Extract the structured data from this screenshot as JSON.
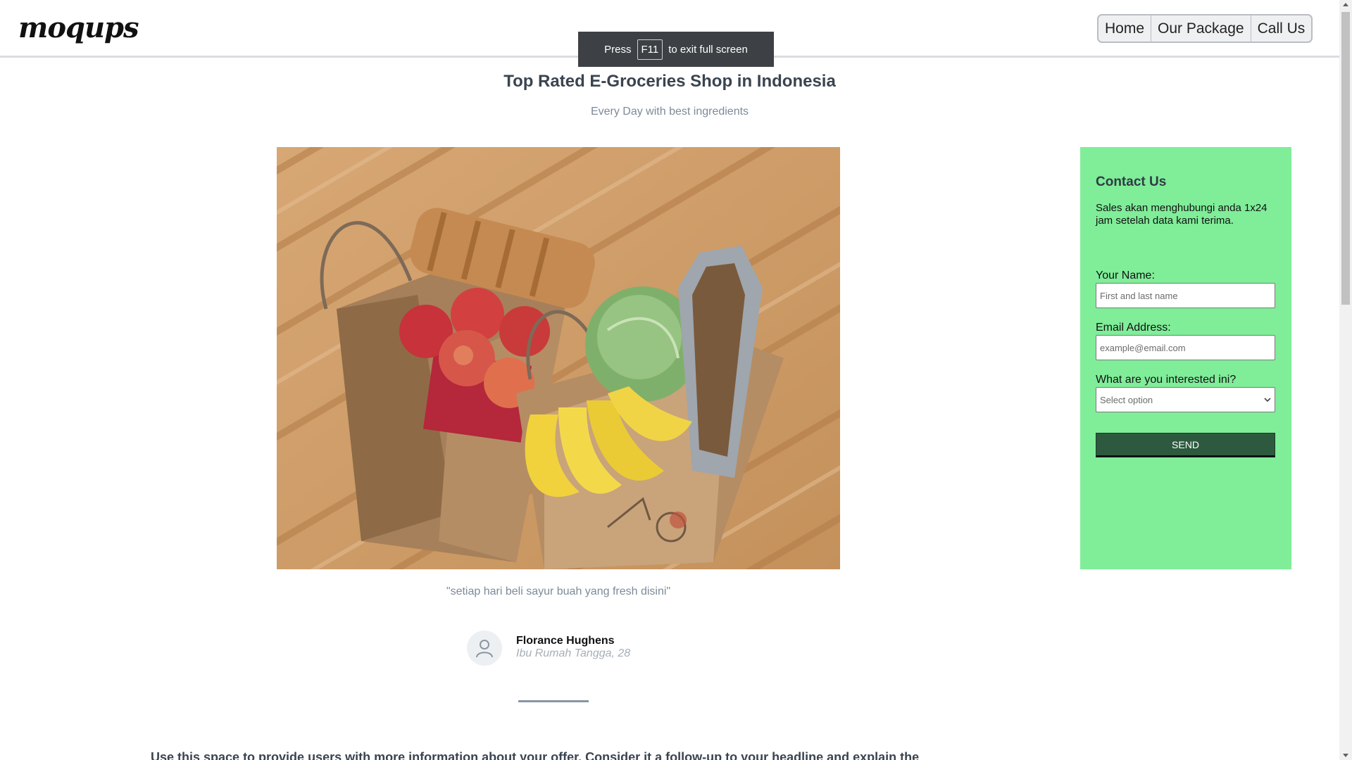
{
  "header": {
    "logo": "moqups",
    "nav": [
      "Home",
      "Our Package",
      "Call Us"
    ]
  },
  "toast": {
    "press": "Press",
    "key": "F11",
    "rest": "to exit full screen"
  },
  "hero": {
    "title": "Top Rated E-Groceries Shop in Indonesia",
    "subtitle": "Every Day with best ingredients",
    "quote": "\"setiap hari beli sayur buah yang fresh disini\""
  },
  "testimonial": {
    "name": "Florance Hughens",
    "role": "Ibu Rumah Tangga, 28"
  },
  "body_text": "Use this space to provide users with more information about your offer. Consider it a follow-up to your headline and explain the",
  "contact": {
    "title": "Contact Us",
    "description": "Sales akan menghubungi anda 1x24 jam setelah data kami terima.",
    "name_label": "Your Name:",
    "name_placeholder": "First and last name",
    "email_label": "Email Address:",
    "email_placeholder": "example@email.com",
    "interest_label": "What are you interested ini?",
    "select_value": "Select option",
    "send_label": "SEND",
    "panel_color": "#80ed99",
    "button_color": "#2d5a3f"
  }
}
